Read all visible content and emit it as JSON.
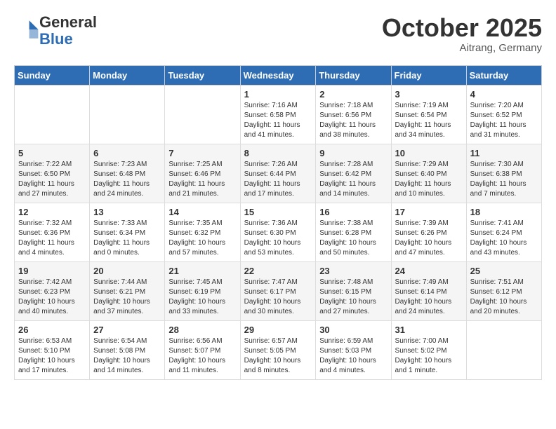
{
  "header": {
    "logo_line1": "General",
    "logo_line2": "Blue",
    "month": "October 2025",
    "location": "Aitrang, Germany"
  },
  "weekdays": [
    "Sunday",
    "Monday",
    "Tuesday",
    "Wednesday",
    "Thursday",
    "Friday",
    "Saturday"
  ],
  "weeks": [
    [
      {
        "day": "",
        "info": ""
      },
      {
        "day": "",
        "info": ""
      },
      {
        "day": "",
        "info": ""
      },
      {
        "day": "1",
        "info": "Sunrise: 7:16 AM\nSunset: 6:58 PM\nDaylight: 11 hours and 41 minutes."
      },
      {
        "day": "2",
        "info": "Sunrise: 7:18 AM\nSunset: 6:56 PM\nDaylight: 11 hours and 38 minutes."
      },
      {
        "day": "3",
        "info": "Sunrise: 7:19 AM\nSunset: 6:54 PM\nDaylight: 11 hours and 34 minutes."
      },
      {
        "day": "4",
        "info": "Sunrise: 7:20 AM\nSunset: 6:52 PM\nDaylight: 11 hours and 31 minutes."
      }
    ],
    [
      {
        "day": "5",
        "info": "Sunrise: 7:22 AM\nSunset: 6:50 PM\nDaylight: 11 hours and 27 minutes."
      },
      {
        "day": "6",
        "info": "Sunrise: 7:23 AM\nSunset: 6:48 PM\nDaylight: 11 hours and 24 minutes."
      },
      {
        "day": "7",
        "info": "Sunrise: 7:25 AM\nSunset: 6:46 PM\nDaylight: 11 hours and 21 minutes."
      },
      {
        "day": "8",
        "info": "Sunrise: 7:26 AM\nSunset: 6:44 PM\nDaylight: 11 hours and 17 minutes."
      },
      {
        "day": "9",
        "info": "Sunrise: 7:28 AM\nSunset: 6:42 PM\nDaylight: 11 hours and 14 minutes."
      },
      {
        "day": "10",
        "info": "Sunrise: 7:29 AM\nSunset: 6:40 PM\nDaylight: 11 hours and 10 minutes."
      },
      {
        "day": "11",
        "info": "Sunrise: 7:30 AM\nSunset: 6:38 PM\nDaylight: 11 hours and 7 minutes."
      }
    ],
    [
      {
        "day": "12",
        "info": "Sunrise: 7:32 AM\nSunset: 6:36 PM\nDaylight: 11 hours and 4 minutes."
      },
      {
        "day": "13",
        "info": "Sunrise: 7:33 AM\nSunset: 6:34 PM\nDaylight: 11 hours and 0 minutes."
      },
      {
        "day": "14",
        "info": "Sunrise: 7:35 AM\nSunset: 6:32 PM\nDaylight: 10 hours and 57 minutes."
      },
      {
        "day": "15",
        "info": "Sunrise: 7:36 AM\nSunset: 6:30 PM\nDaylight: 10 hours and 53 minutes."
      },
      {
        "day": "16",
        "info": "Sunrise: 7:38 AM\nSunset: 6:28 PM\nDaylight: 10 hours and 50 minutes."
      },
      {
        "day": "17",
        "info": "Sunrise: 7:39 AM\nSunset: 6:26 PM\nDaylight: 10 hours and 47 minutes."
      },
      {
        "day": "18",
        "info": "Sunrise: 7:41 AM\nSunset: 6:24 PM\nDaylight: 10 hours and 43 minutes."
      }
    ],
    [
      {
        "day": "19",
        "info": "Sunrise: 7:42 AM\nSunset: 6:23 PM\nDaylight: 10 hours and 40 minutes."
      },
      {
        "day": "20",
        "info": "Sunrise: 7:44 AM\nSunset: 6:21 PM\nDaylight: 10 hours and 37 minutes."
      },
      {
        "day": "21",
        "info": "Sunrise: 7:45 AM\nSunset: 6:19 PM\nDaylight: 10 hours and 33 minutes."
      },
      {
        "day": "22",
        "info": "Sunrise: 7:47 AM\nSunset: 6:17 PM\nDaylight: 10 hours and 30 minutes."
      },
      {
        "day": "23",
        "info": "Sunrise: 7:48 AM\nSunset: 6:15 PM\nDaylight: 10 hours and 27 minutes."
      },
      {
        "day": "24",
        "info": "Sunrise: 7:49 AM\nSunset: 6:14 PM\nDaylight: 10 hours and 24 minutes."
      },
      {
        "day": "25",
        "info": "Sunrise: 7:51 AM\nSunset: 6:12 PM\nDaylight: 10 hours and 20 minutes."
      }
    ],
    [
      {
        "day": "26",
        "info": "Sunrise: 6:53 AM\nSunset: 5:10 PM\nDaylight: 10 hours and 17 minutes."
      },
      {
        "day": "27",
        "info": "Sunrise: 6:54 AM\nSunset: 5:08 PM\nDaylight: 10 hours and 14 minutes."
      },
      {
        "day": "28",
        "info": "Sunrise: 6:56 AM\nSunset: 5:07 PM\nDaylight: 10 hours and 11 minutes."
      },
      {
        "day": "29",
        "info": "Sunrise: 6:57 AM\nSunset: 5:05 PM\nDaylight: 10 hours and 8 minutes."
      },
      {
        "day": "30",
        "info": "Sunrise: 6:59 AM\nSunset: 5:03 PM\nDaylight: 10 hours and 4 minutes."
      },
      {
        "day": "31",
        "info": "Sunrise: 7:00 AM\nSunset: 5:02 PM\nDaylight: 10 hours and 1 minute."
      },
      {
        "day": "",
        "info": ""
      }
    ]
  ]
}
